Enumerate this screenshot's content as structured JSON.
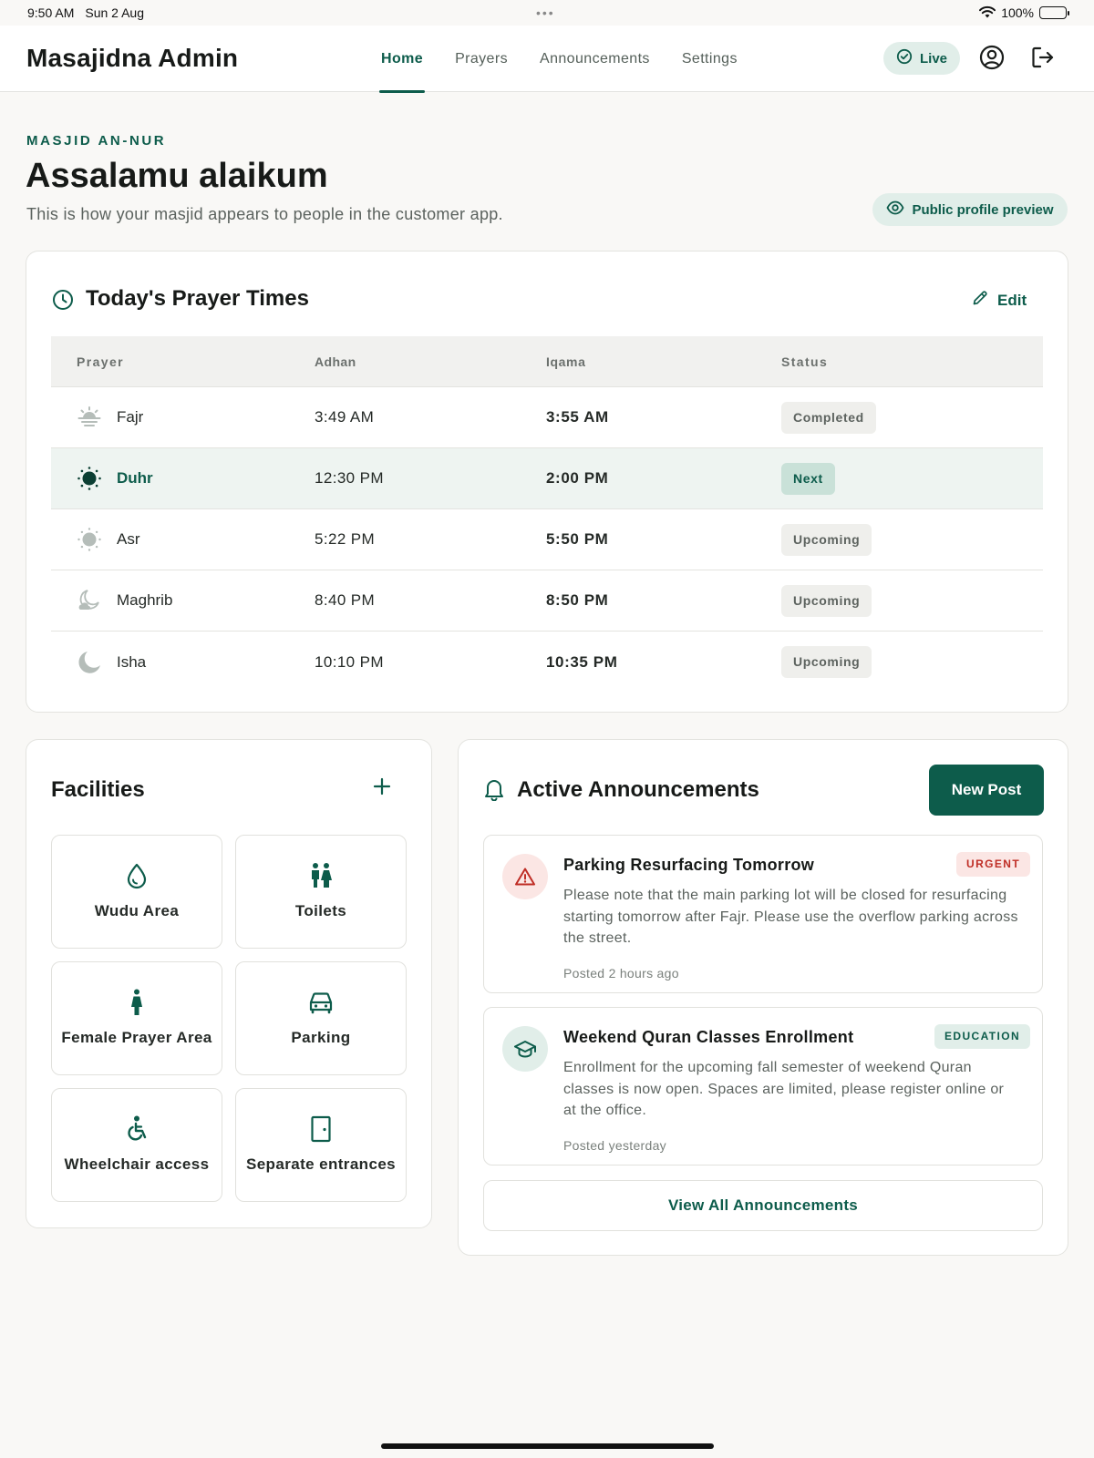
{
  "status_bar": {
    "time": "9:50 AM",
    "date": "Sun 2 Aug",
    "dots": "•••",
    "battery": "100%"
  },
  "header": {
    "brand": "Masajidna Admin",
    "tabs": [
      {
        "label": "Home",
        "active": true
      },
      {
        "label": "Prayers",
        "active": false
      },
      {
        "label": "Announcements",
        "active": false
      },
      {
        "label": "Settings",
        "active": false
      }
    ],
    "live_label": "Live",
    "icons": [
      "check-circle-icon",
      "user-circle-icon",
      "logout-icon"
    ]
  },
  "intro": {
    "eyebrow": "MASJID AN-NUR",
    "greeting": "Assalamu alaikum",
    "subtitle": "This is how your masjid appears to people in the customer app.",
    "preview_label": "Public profile preview"
  },
  "prayer_times": {
    "title": "Today's Prayer Times",
    "edit_label": "Edit",
    "columns": [
      "Prayer",
      "Adhan",
      "Iqama",
      "Status"
    ],
    "rows": [
      {
        "prayer": "Fajr",
        "adhan": "3:49 AM",
        "iqama": "3:55 AM",
        "status": "Completed",
        "icon": "sunrise-icon"
      },
      {
        "prayer": "Duhr",
        "adhan": "12:30 PM",
        "iqama": "2:00 PM",
        "status": "Next",
        "icon": "sun-icon"
      },
      {
        "prayer": "Asr",
        "adhan": "5:22 PM",
        "iqama": "5:50 PM",
        "status": "Upcoming",
        "icon": "sun-dim-icon"
      },
      {
        "prayer": "Maghrib",
        "adhan": "8:40 PM",
        "iqama": "8:50 PM",
        "status": "Upcoming",
        "icon": "moon-cloud-icon"
      },
      {
        "prayer": "Isha",
        "adhan": "10:10 PM",
        "iqama": "10:35 PM",
        "status": "Upcoming",
        "icon": "moon-icon"
      }
    ]
  },
  "facilities": {
    "title": "Facilities",
    "items": [
      {
        "label": "Wudu Area",
        "icon": "water-drop-icon"
      },
      {
        "label": "Toilets",
        "icon": "restroom-icon"
      },
      {
        "label": "Female Prayer Area",
        "icon": "female-icon"
      },
      {
        "label": "Parking",
        "icon": "car-icon"
      },
      {
        "label": "Wheelchair access",
        "icon": "wheelchair-icon"
      },
      {
        "label": "Separate entrances",
        "icon": "door-icon"
      }
    ]
  },
  "announcements": {
    "title": "Active Announcements",
    "new_post_label": "New Post",
    "items": [
      {
        "title": "Parking Resurfacing Tomorrow",
        "tag": "URGENT",
        "body": "Please note that the main parking lot will be closed for resurfacing starting tomorrow after Fajr. Please use the overflow parking across the street.",
        "time": "Posted 2 hours ago",
        "icon": "warning-icon"
      },
      {
        "title": "Weekend Quran Classes Enrollment",
        "tag": "EDUCATION",
        "body": "Enrollment for the upcoming fall semester of weekend Quran classes is now open. Spaces are limited, please register online or at the office.",
        "time": "Posted yesterday",
        "icon": "graduation-cap-icon"
      }
    ],
    "view_all_label": "View All Announcements"
  },
  "colors": {
    "accent": "#0d5c4b",
    "accent_soft": "#e1eee9",
    "urgent": "#bf2d25",
    "background": "#f9f8f6"
  }
}
